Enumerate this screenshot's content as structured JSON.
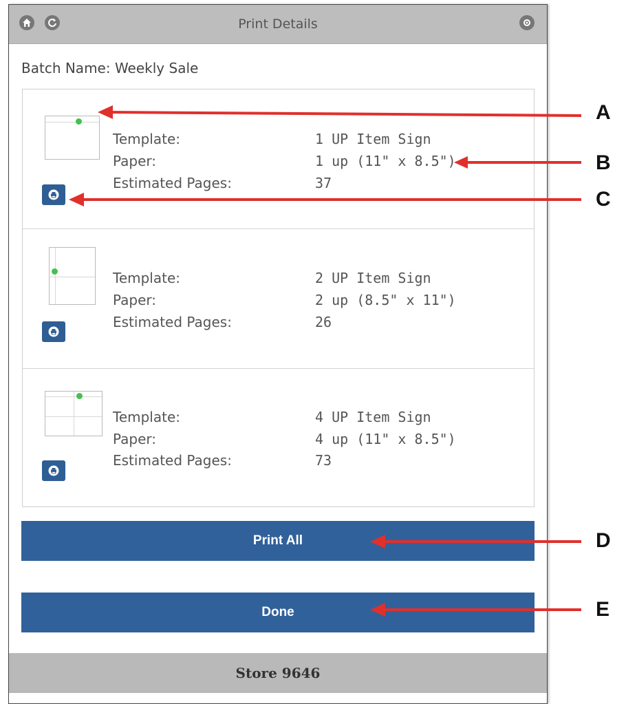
{
  "window": {
    "title": "Print Details",
    "left_icons": [
      "home-icon",
      "refresh-icon"
    ],
    "right_icon": "settings-icon"
  },
  "batch": {
    "label": "Batch Name: Weekly Sale"
  },
  "items": [
    {
      "labels": {
        "template": "Template:",
        "paper": "Paper:",
        "pages": "Estimated Pages:"
      },
      "template": "1 UP Item Sign",
      "paper": "1 up (11\" x 8.5\")",
      "pages": "37",
      "thumb": "landscape-1up"
    },
    {
      "labels": {
        "template": "Template:",
        "paper": "Paper:",
        "pages": "Estimated Pages:"
      },
      "template": "2 UP Item Sign",
      "paper": "2 up (8.5\" x 11\")",
      "pages": "26",
      "thumb": "portrait-2up"
    },
    {
      "labels": {
        "template": "Template:",
        "paper": "Paper:",
        "pages": "Estimated Pages:"
      },
      "template": "4 UP Item Sign",
      "paper": "4 up (11\" x 8.5\")",
      "pages": "73",
      "thumb": "landscape-4up"
    }
  ],
  "buttons": {
    "print_all": "Print All",
    "done": "Done"
  },
  "footer": {
    "store": "Store 9646"
  },
  "callouts": [
    "A",
    "B",
    "C",
    "D",
    "E"
  ],
  "colors": {
    "button_blue": "#31619b",
    "thumb_dot": "#43c14f",
    "arrow_red": "#e0302c"
  }
}
